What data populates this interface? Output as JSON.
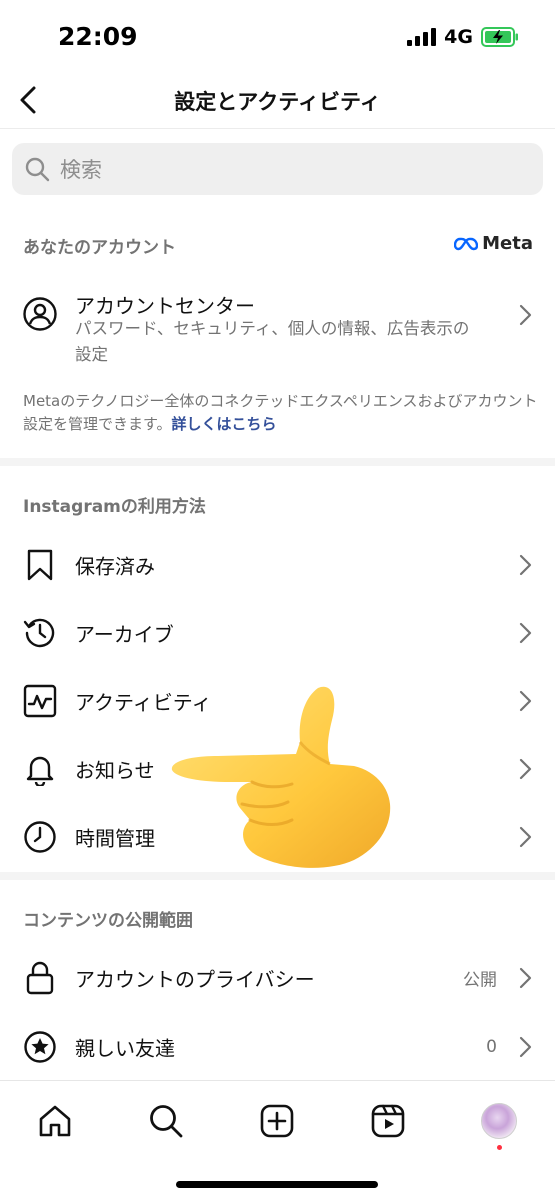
{
  "status_bar": {
    "time": "22:09",
    "network": "4G"
  },
  "nav": {
    "title": "設定とアクティビティ"
  },
  "search": {
    "placeholder": "検索"
  },
  "your_account": {
    "header": "あなたのアカウント",
    "meta_logo": "Meta",
    "account_center": {
      "title": "アカウントセンター",
      "subtitle": "パスワード、セキュリティ、個人の情報、広告表示の設定"
    },
    "description": "Metaのテクノロジー全体のコネクテッドエクスペリエンスおよびアカウント設定を管理できます。",
    "learn_more": "詳しくはこちら"
  },
  "how_you_use": {
    "header": "Instagramの利用方法",
    "items": [
      {
        "label": "保存済み",
        "icon": "bookmark-icon"
      },
      {
        "label": "アーカイブ",
        "icon": "archive-icon"
      },
      {
        "label": "アクティビティ",
        "icon": "activity-icon"
      },
      {
        "label": "お知らせ",
        "icon": "bell-icon"
      },
      {
        "label": "時間管理",
        "icon": "clock-icon"
      }
    ]
  },
  "content_visibility": {
    "header": "コンテンツの公開範囲",
    "items": [
      {
        "label": "アカウントのプライバシー",
        "value": "公開",
        "icon": "lock-icon"
      },
      {
        "label": "親しい友達",
        "value": "0",
        "icon": "star-icon"
      }
    ]
  },
  "tab_bar": {
    "tabs": [
      "home-icon",
      "search-icon",
      "create-icon",
      "reels-icon",
      "profile-avatar"
    ]
  },
  "colors": {
    "link": "#34509a",
    "secondary_text": "#737373",
    "battery": "#34c759",
    "notification_dot": "#ff3040"
  }
}
